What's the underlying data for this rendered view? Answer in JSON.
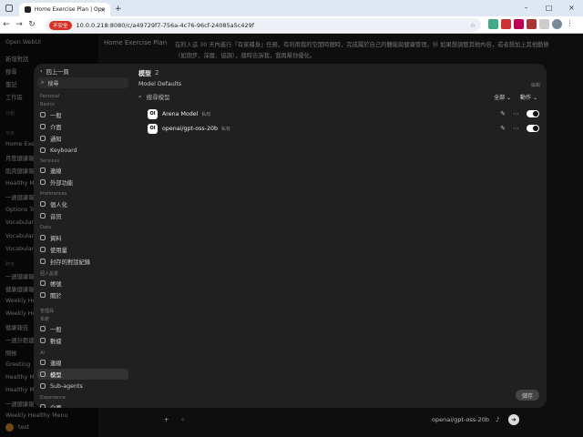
{
  "browser": {
    "tab_title": "Home Exercise Plan | Open WebUI",
    "url": "10.0.0.218:8080/c/a49729f7-756a-4c76-96cf-24085a5c429f",
    "security": "不安全"
  },
  "app": {
    "name": "Open WebUI",
    "chat_title": "Home Exercise Plan",
    "sidebar_items": [
      "新增對話",
      "搜尋",
      "筆記",
      "工作區"
    ],
    "sidebar_groups": [
      "分組",
      "今天",
      "昨天"
    ],
    "chats": [
      "Home Exercise",
      "月度健康報",
      "肌肉健康報",
      "Healthy Me",
      "一週健康報",
      "Options Tr",
      "Vocabulary",
      "Vocabulary",
      "Vocabulary",
      "一週健康報",
      "健康健康報",
      "Weekly He",
      "Weekly He",
      "健康報告",
      "一週計劃建",
      "問候",
      "Greeting",
      "Healthy Me",
      "Healthy Me",
      "一週健康報",
      "Weekly Healthy Menu"
    ],
    "user": "test",
    "bottom_model": "openai/gpt-oss-20b",
    "main_text": "在的人這 30 天內進行『有家補身』任務，有利用我的空閒時間時，完成屬於自己的體能與健康管理。Ⓜ 如果想調整其他內容，或者想加上其他動態（如期步、深層、協調），隨時告訴我，我再幫你優化。"
  },
  "modal": {
    "back": "回上一頁",
    "search_placeholder": "搜尋",
    "sections": {
      "personal": "Personal",
      "basics": "Basics",
      "services": "Services",
      "preferences": "Preferences",
      "data": "Data",
      "user_tools": "個人設置",
      "admin": "管理員",
      "general_admin": "系統",
      "ai": "AI",
      "experience": "Experience"
    },
    "items": {
      "general": "一般",
      "interface": "介面",
      "notifications": "通知",
      "keyboard": "Keyboard",
      "connections": "連線",
      "external_tools": "外部功能",
      "personalization": "個人化",
      "audio": "音訊",
      "data": "資料",
      "usage": "使用量",
      "archived": "封存的對話紀錄",
      "account": "帳號",
      "about": "關於",
      "admin_general": "一般",
      "database": "數據",
      "ai_connections": "連線",
      "models": "模型",
      "subagents": "Sub-agents",
      "experience_general": "介面"
    },
    "content": {
      "title": "模型",
      "count": "2",
      "defaults": "Model Defaults",
      "setting": "編輯",
      "search_placeholder": "搜尋模型",
      "filter_all": "全部",
      "filter_actions": "動作",
      "models": [
        {
          "logo": "OI",
          "name": "Arena Model",
          "owner": "私有",
          "enabled": true
        },
        {
          "logo": "OI",
          "name": "openai/gpt-oss-20b",
          "owner": "私有",
          "enabled": true
        }
      ],
      "save": "儲存"
    }
  }
}
